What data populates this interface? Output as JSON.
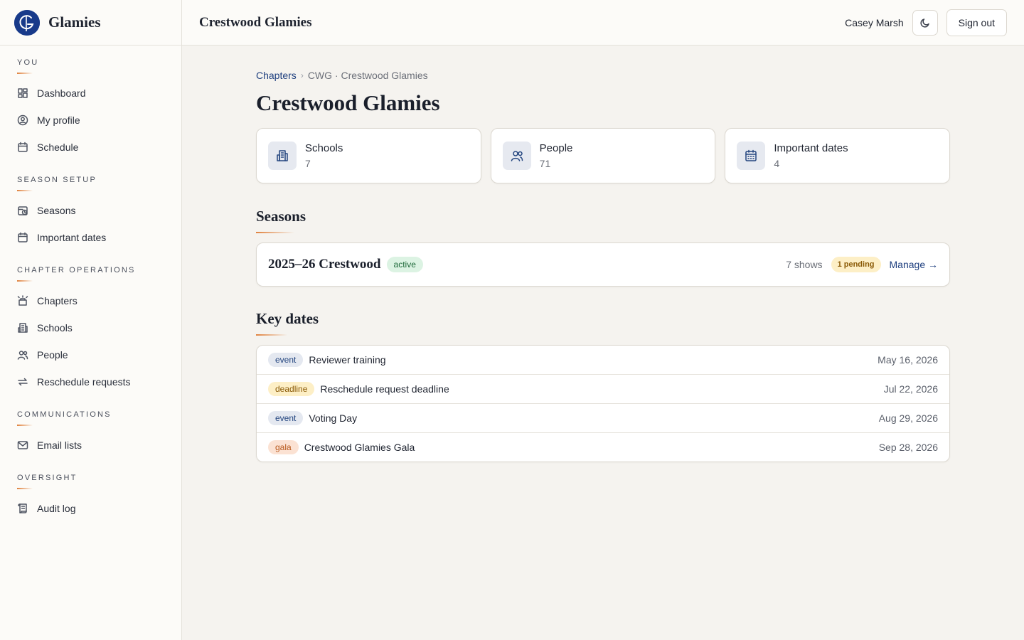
{
  "brand": {
    "name": "Glamies",
    "logo_letter": "G"
  },
  "sidebar": {
    "sections": [
      {
        "title": "YOU",
        "items": [
          {
            "label": "Dashboard",
            "icon": "dashboard-icon"
          },
          {
            "label": "My profile",
            "icon": "user-circle-icon"
          },
          {
            "label": "Schedule",
            "icon": "calendar-icon"
          }
        ]
      },
      {
        "title": "SEASON SETUP",
        "items": [
          {
            "label": "Seasons",
            "icon": "calendar-clock-icon"
          },
          {
            "label": "Important dates",
            "icon": "calendar-icon"
          }
        ]
      },
      {
        "title": "CHAPTER OPERATIONS",
        "items": [
          {
            "label": "Chapters",
            "icon": "chapters-icon"
          },
          {
            "label": "Schools",
            "icon": "building-icon"
          },
          {
            "label": "People",
            "icon": "users-icon"
          },
          {
            "label": "Reschedule requests",
            "icon": "swap-icon"
          }
        ]
      },
      {
        "title": "COMMUNICATIONS",
        "items": [
          {
            "label": "Email lists",
            "icon": "mail-icon"
          }
        ]
      },
      {
        "title": "OVERSIGHT",
        "items": [
          {
            "label": "Audit log",
            "icon": "scroll-icon"
          }
        ]
      }
    ]
  },
  "topbar": {
    "title": "Crestwood Glamies",
    "user_name": "Casey Marsh",
    "theme_toggle_icon": "moon-icon",
    "sign_out_label": "Sign out"
  },
  "breadcrumb": {
    "root": "Chapters",
    "current": "CWG · Crestwood Glamies"
  },
  "page": {
    "title": "Crestwood Glamies"
  },
  "stats": [
    {
      "label": "Schools",
      "value": "7",
      "icon": "building-icon"
    },
    {
      "label": "People",
      "value": "71",
      "icon": "users-icon"
    },
    {
      "label": "Important dates",
      "value": "4",
      "icon": "calendar-icon"
    }
  ],
  "seasons": {
    "heading": "Seasons",
    "items": [
      {
        "name": "2025–26 Crestwood",
        "status": "active",
        "shows": "7 shows",
        "pending": "1 pending",
        "manage_label": "Manage →"
      }
    ]
  },
  "key_dates": {
    "heading": "Key dates",
    "items": [
      {
        "tag": "event",
        "name": "Reviewer training",
        "date": "May 16, 2026"
      },
      {
        "tag": "deadline",
        "name": "Reschedule request deadline",
        "date": "Jul 22, 2026"
      },
      {
        "tag": "event",
        "name": "Voting Day",
        "date": "Aug 29, 2026"
      },
      {
        "tag": "gala",
        "name": "Crestwood Glamies Gala",
        "date": "Sep 28, 2026"
      }
    ]
  },
  "colors": {
    "accent": "#e0823e",
    "brand_blue": "#183a8a",
    "link": "#1e3f7f"
  }
}
